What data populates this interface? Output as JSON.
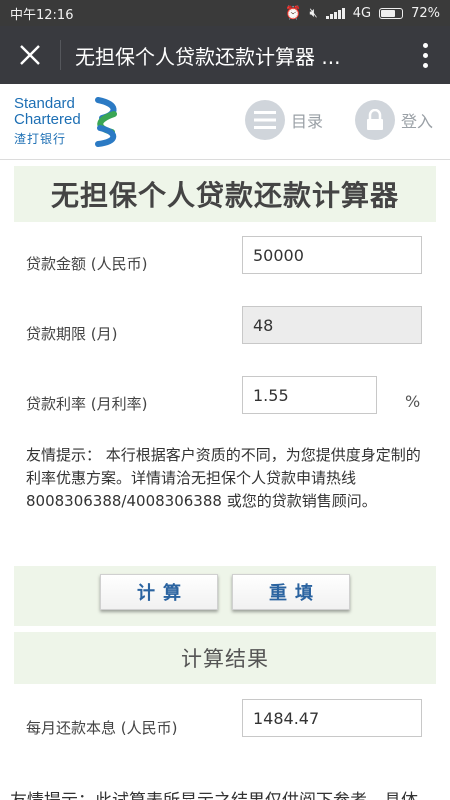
{
  "status_bar": {
    "time": "中午12:16",
    "network": "4G",
    "battery": "72%",
    "battery_level": 0.72
  },
  "title_bar": {
    "title": "无担保个人贷款还款计算器 ..."
  },
  "bank": {
    "logo_line1": "Standard",
    "logo_line2": "Chartered",
    "logo_cn": "渣打银行",
    "nav_menu": "目录",
    "nav_login": "登入"
  },
  "page_title": "无担保个人贷款还款计算器",
  "form": {
    "amount_label": "贷款金额 (人民币)",
    "amount_value": "50000",
    "term_label": "贷款期限 (月)",
    "term_value": "48",
    "rate_label": "贷款利率 (月利率)",
    "rate_value": "1.55",
    "rate_unit": "%"
  },
  "tips": "友情提示： 本行根据客户资质的不同，为您提供度身定制的利率优惠方案。详情请洽无担保个人贷款申请热线 8008306388/4008306388 或您的贷款销售顾问。",
  "buttons": {
    "calculate": "计算",
    "reset": "重填"
  },
  "result": {
    "title": "计算结果",
    "monthly_label": "每月还款本息 (人民币)",
    "monthly_value": "1484.47"
  },
  "bottom_tip": "友情提示：此试算表所显示之结果仅供阅下参考，具体",
  "colors": {
    "accent_blue": "#1d6fb4",
    "button_text": "#2a63a0",
    "banner_bg": "#eef5e9",
    "title_bar_bg": "#393a3f"
  }
}
